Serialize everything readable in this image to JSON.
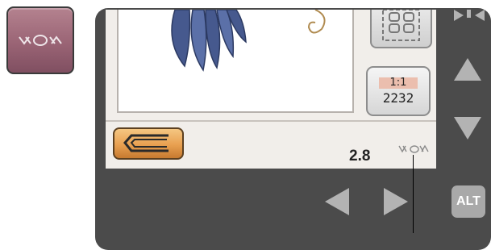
{
  "left_panel": {
    "stitch_icon": "stitch-pattern-icon"
  },
  "screen": {
    "zoom": {
      "ratio": "1:1",
      "number": "2232"
    },
    "stitch_width": "2.8",
    "icons": {
      "back": "return-arrow-icon",
      "layout": "hoop-layout-icon",
      "stitch": "stitch-pattern-icon"
    }
  },
  "controls": {
    "up": "up-arrow-icon",
    "down": "down-arrow-icon",
    "left": "left-arrow-icon",
    "right": "right-arrow-icon",
    "play": "play-icon",
    "alt_label": "ALT"
  },
  "colors": {
    "bezel": "#4b4b4b",
    "screen": "#f1eeea",
    "stitch_button": "#9a6475",
    "back_button": "#e8a050",
    "feather": "#46598e"
  }
}
